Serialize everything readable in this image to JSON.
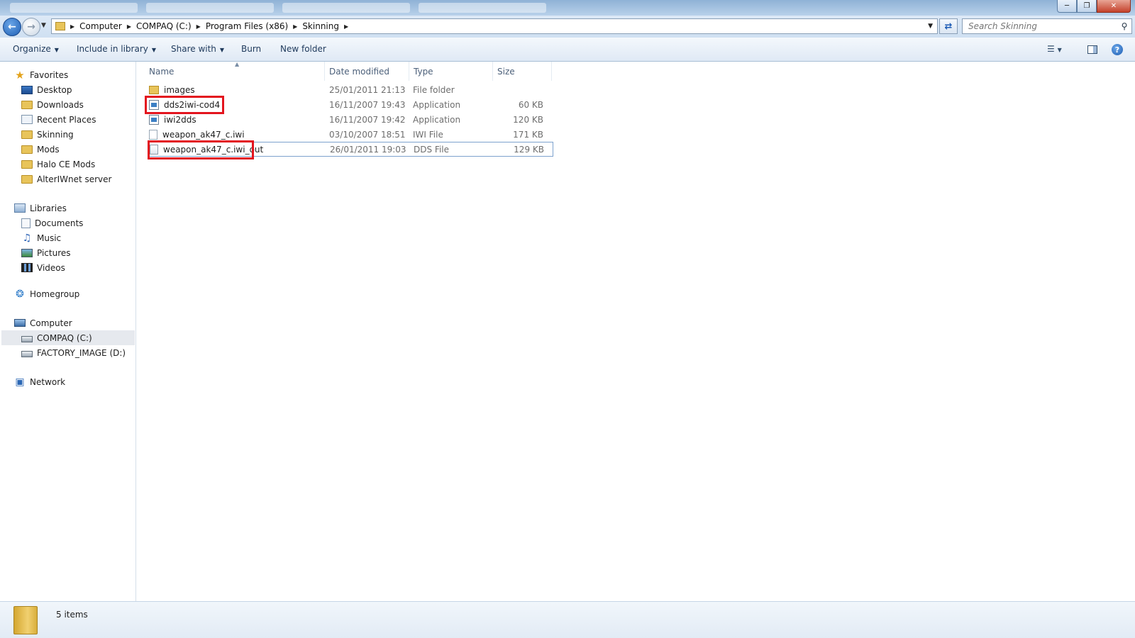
{
  "address": {
    "crumbs": [
      "Computer",
      "COMPAQ (C:)",
      "Program Files (x86)",
      "Skinning"
    ]
  },
  "search": {
    "placeholder": "Search Skinning"
  },
  "toolbar": {
    "organize": "Organize",
    "include_in_library": "Include in library",
    "share_with": "Share with",
    "burn": "Burn",
    "new_folder": "New folder"
  },
  "nav": {
    "favorites_label": "Favorites",
    "favorites": [
      "Desktop",
      "Downloads",
      "Recent Places",
      "Skinning",
      "Mods",
      "Halo CE Mods",
      "AlterIWnet server"
    ],
    "libraries_label": "Libraries",
    "libraries": [
      "Documents",
      "Music",
      "Pictures",
      "Videos"
    ],
    "homegroup": "Homegroup",
    "computer_label": "Computer",
    "drives": [
      "COMPAQ (C:)",
      "FACTORY_IMAGE (D:)"
    ],
    "selected_drive": "COMPAQ (C:)",
    "network": "Network"
  },
  "columns": {
    "name": "Name",
    "date": "Date modified",
    "type": "Type",
    "size": "Size"
  },
  "files": [
    {
      "name": "images",
      "date": "25/01/2011 21:13",
      "type": "File folder",
      "size": "",
      "icon": "folder-icon"
    },
    {
      "name": "dds2iwi-cod4",
      "date": "16/11/2007 19:43",
      "type": "Application",
      "size": "60 KB",
      "icon": "application-icon",
      "highlighted": true
    },
    {
      "name": "iwi2dds",
      "date": "16/11/2007 19:42",
      "type": "Application",
      "size": "120 KB",
      "icon": "application-icon"
    },
    {
      "name": "weapon_ak47_c.iwi",
      "date": "03/10/2007 18:51",
      "type": "IWI File",
      "size": "171 KB",
      "icon": "file-icon"
    },
    {
      "name": "weapon_ak47_c.iwi_out",
      "date": "26/01/2011 19:03",
      "type": "DDS File",
      "size": "129 KB",
      "icon": "dds-file-icon",
      "highlighted": true,
      "focused": true
    }
  ],
  "status": {
    "item_count": "5 items"
  },
  "colors": {
    "annotation": "#e3141e",
    "selection": "#e6e9ee",
    "focus_border": "#7da2ce"
  }
}
